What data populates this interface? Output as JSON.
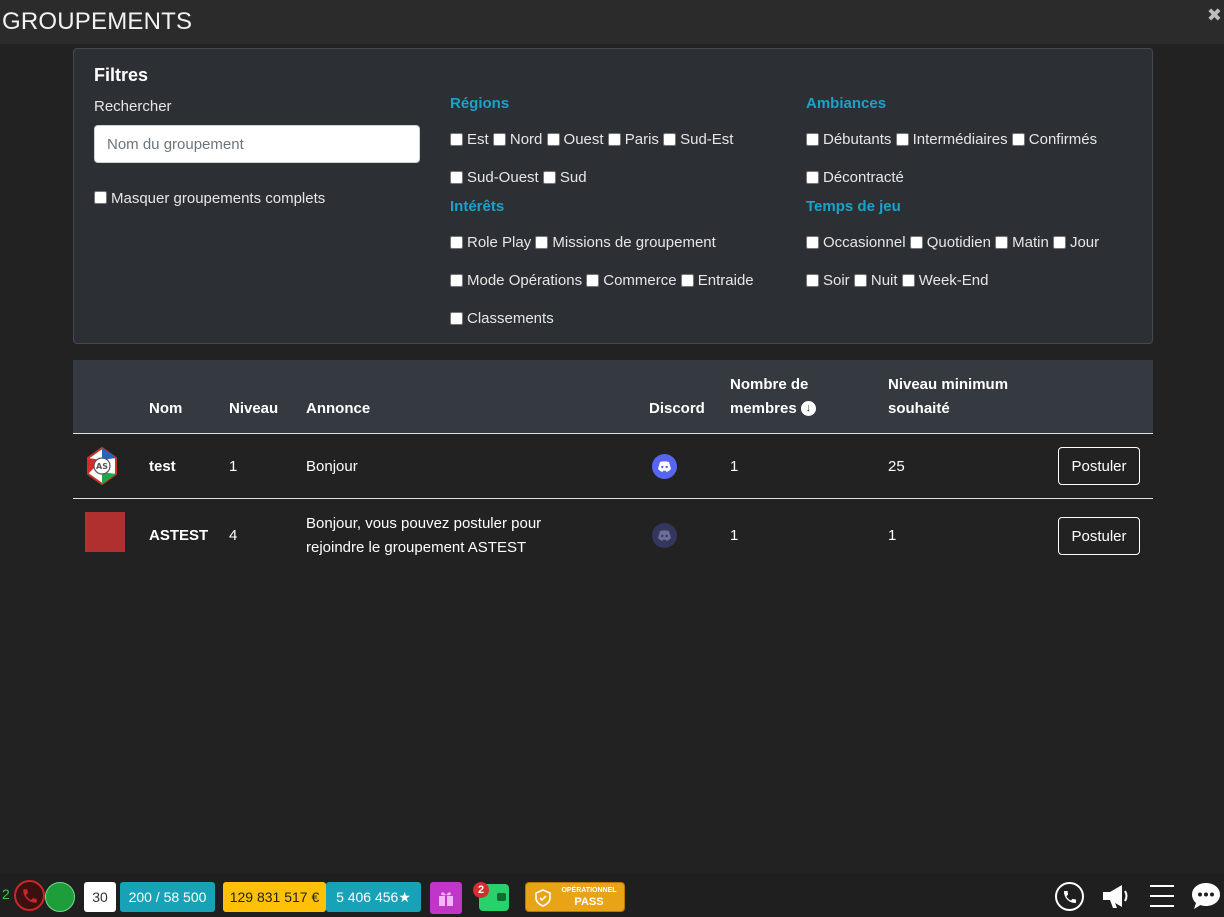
{
  "window": {
    "title": "GROUPEMENTS",
    "close_symbol": "✖"
  },
  "filters": {
    "title": "Filtres",
    "search_label": "Rechercher",
    "search_placeholder": "Nom du groupement",
    "search_value": "",
    "hide_full_label": "Masquer groupements complets",
    "groups": {
      "regions": {
        "title": "Régions",
        "options": [
          "Est",
          "Nord",
          "Ouest",
          "Paris",
          "Sud-Est",
          "Sud-Ouest",
          "Sud"
        ]
      },
      "ambiances": {
        "title": "Ambiances",
        "options": [
          "Débutants",
          "Intermédiaires",
          "Confirmés",
          "Décontracté"
        ]
      },
      "interets": {
        "title": "Intérêts",
        "options": [
          "Role Play",
          "Missions de groupement",
          "Mode Opérations",
          "Commerce",
          "Entraide",
          "Classements"
        ]
      },
      "temps": {
        "title": "Temps de jeu",
        "options": [
          "Occasionnel",
          "Quotidien",
          "Matin",
          "Jour",
          "Soir",
          "Nuit",
          "Week-End"
        ]
      }
    },
    "colors": {
      "group_title": "#1ba2c9",
      "panel_bg": "#2c3035"
    }
  },
  "table": {
    "headers": {
      "nom": "Nom",
      "niveau": "Niveau",
      "annonce": "Annonce",
      "discord": "Discord",
      "membres_line1": "Nombre de",
      "membres_line2": "membres",
      "niveau_min_line1": "Niveau minimum",
      "niveau_min_line2": "souhaité"
    },
    "rows": [
      {
        "nom": "test",
        "niveau": "1",
        "annonce_line1": "Bonjour",
        "annonce_line2": "",
        "discord": "active",
        "membres": "1",
        "niveau_min": "25",
        "action": "Postuler"
      },
      {
        "nom": "ASTEST",
        "niveau": "4",
        "annonce_line1": "Bonjour, vous pouvez postuler pour",
        "annonce_line2": "rejoindre le groupement ASTEST",
        "discord": "inactive",
        "membres": "1",
        "niveau_min": "1",
        "action": "Postuler"
      }
    ],
    "colors": {
      "header_bg": "#343a40",
      "discord_on": "#5865f2",
      "discord_off": "#34375c"
    }
  },
  "bottombar": {
    "calls_count": "2",
    "level": "30",
    "xp": "200 / 58 500",
    "money": "129 831 517 €",
    "points": "5 406 456",
    "wallet_badge": "2",
    "pass_line1": "OPÉRATIONNEL",
    "pass_line2": "PASS",
    "colors": {
      "xp": "#17a2b8",
      "money": "#ffc107",
      "points": "#17a2b8",
      "gift": "#c136c9",
      "wallet": "#28d16a",
      "pass": "#e8a317"
    }
  }
}
